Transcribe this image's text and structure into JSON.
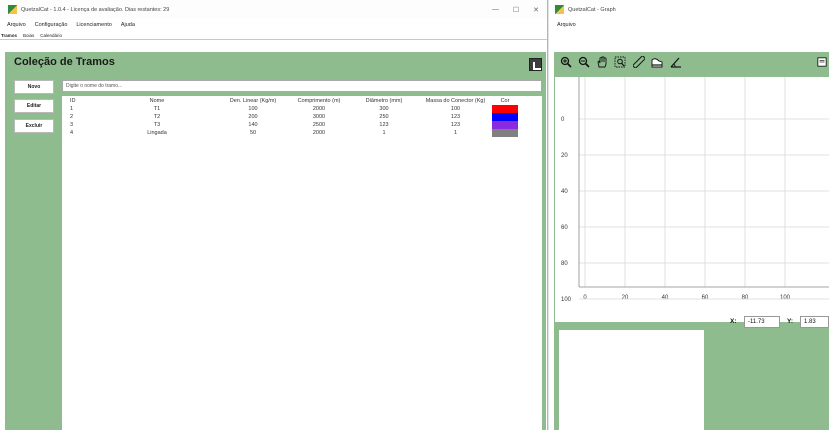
{
  "main": {
    "window_title": "QuetzalCat - 1.0.4 - Licença de avaliação. Dias restantes: 29",
    "window_controls": [
      "—",
      "☐",
      "✕"
    ],
    "menu": [
      "Arquivo",
      "Configuração",
      "Licenciamento",
      "Ajuda"
    ],
    "tabs": [
      "Tramos",
      "Boias",
      "Calendário"
    ],
    "collection_title": "Coleção de Tramos",
    "buttons": {
      "new": "Novo",
      "edit": "Editar",
      "delete": "Excluir"
    },
    "search_placeholder": "Digite o nome do tramo...",
    "table": {
      "headers": [
        "ID",
        "Nome",
        "Den. Linear (Kg/m)",
        "Comprimento (m)",
        "Diâmetro (mm)",
        "Massa do Conector (Kg)",
        "Cor"
      ],
      "rows": [
        {
          "id": "1",
          "name": "T1",
          "density": "100",
          "length": "2000",
          "diameter": "300",
          "mass": "100",
          "color": "#ff0000"
        },
        {
          "id": "2",
          "name": "T2",
          "density": "200",
          "length": "3000",
          "diameter": "250",
          "mass": "123",
          "color": "#0000ff"
        },
        {
          "id": "3",
          "name": "T3",
          "density": "140",
          "length": "2500",
          "diameter": "123",
          "mass": "123",
          "color": "#8a2be2"
        },
        {
          "id": "4",
          "name": "Lingada",
          "density": "50",
          "length": "2000",
          "diameter": "1",
          "mass": "1",
          "color": "#808080"
        }
      ]
    },
    "colors": {
      "panel_green": "#8fbc8f"
    }
  },
  "graph": {
    "window_title": "QuetzalCat - Graph",
    "menu": [
      "Arquivo"
    ],
    "toolbar_icons": [
      "zoom-in-icon",
      "zoom-out-icon",
      "pan-hand-icon",
      "zoom-region-icon",
      "ruler-icon",
      "profile-icon",
      "angle-icon",
      "export-icon"
    ],
    "x_ticks": [
      "0",
      "20",
      "40",
      "60",
      "80",
      "100"
    ],
    "y_ticks": [
      "0",
      "20",
      "40",
      "60",
      "80",
      "100"
    ],
    "coords": {
      "x_label": "X:",
      "x_value": "-11.73",
      "y_label": "Y:",
      "y_value": "1.83"
    }
  }
}
